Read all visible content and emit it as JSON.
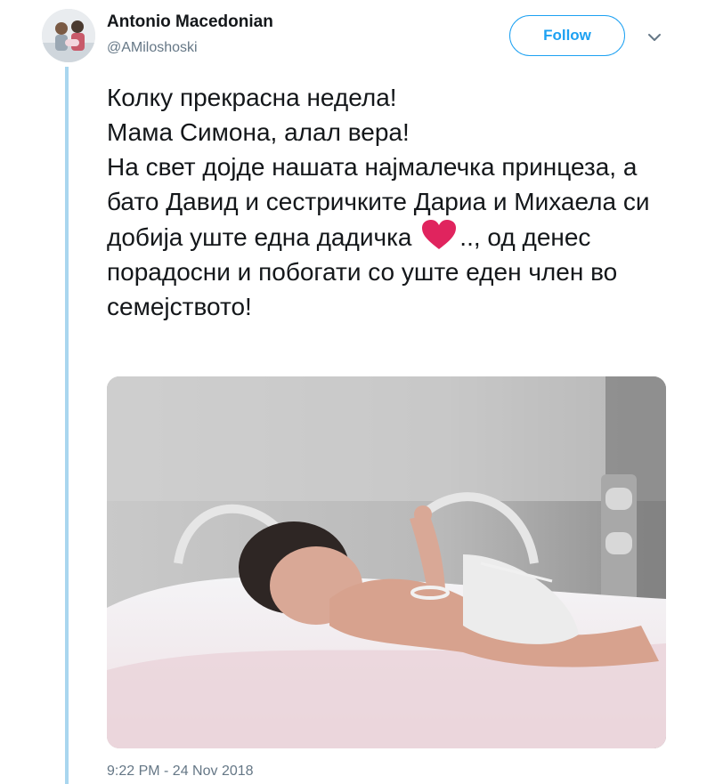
{
  "author": {
    "display_name": "Antonio Macedonian",
    "handle": "@AMiloshoski",
    "avatar_icon": "profile-photo"
  },
  "follow_button": {
    "label": "Follow"
  },
  "more_menu": {
    "icon": "chevron-down-icon"
  },
  "tweet": {
    "text_before_emoji": "Колку прекрасна недела!\nМама Симона, алал вера!\nНа свет дојде нашата најмалечка принцеза, а бато Давид и сестричките Дариа и Михаела си добија уште една дадичка ",
    "emoji": "red-heart",
    "text_after_emoji": ".., од денес порадосни и побогати со уште еден член во семејството!",
    "timestamp": "9:22 PM - 24 Nov 2018"
  },
  "colors": {
    "accent": "#1da1f2",
    "thread_line": "#a9d6ef",
    "heart": "#e0245e",
    "muted_text": "#657786"
  }
}
